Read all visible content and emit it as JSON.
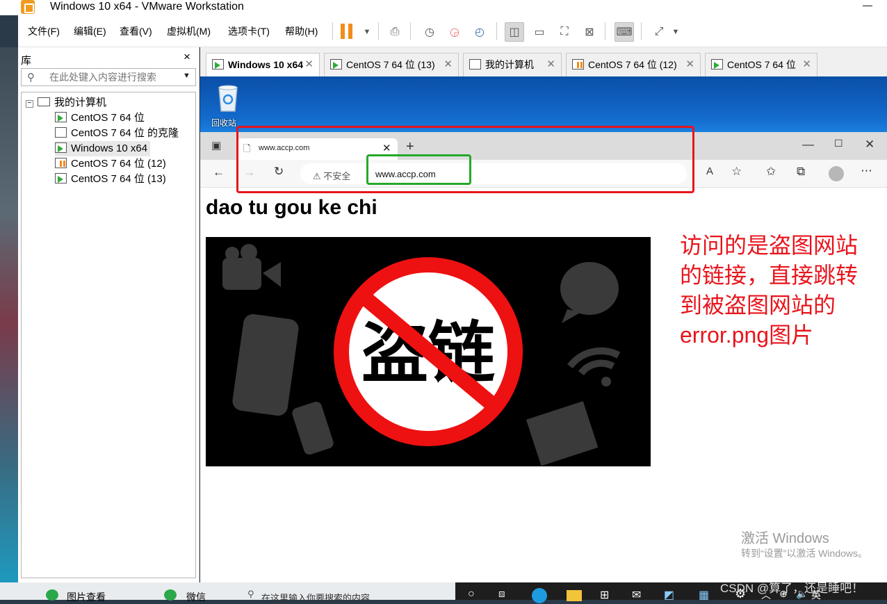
{
  "window": {
    "title": "Windows 10 x64 - VMware Workstation",
    "minimize_glyph": "—"
  },
  "menu": [
    "文件(F)",
    "编辑(E)",
    "查看(V)",
    "虚拟机(M)",
    "选项卡(T)",
    "帮助(H)"
  ],
  "toolbar_icons": [
    "pause-icon",
    "dropdown-icon",
    "send-keys-icon",
    "snapshot-icon",
    "revert-snapshot-icon",
    "snapshot-manager-icon",
    "library-view-icon",
    "console-view-icon",
    "fullscreen-icon",
    "unity-icon",
    "terminal-icon",
    "stretch-icon"
  ],
  "library": {
    "title": "库",
    "close": "×",
    "search_placeholder": "在此处键入内容进行搜索",
    "root": "我的计算机",
    "items": [
      {
        "label": "CentOS 7 64 位",
        "state": "run"
      },
      {
        "label": "CentOS 7 64 位 的克隆",
        "state": "off"
      },
      {
        "label": "Windows 10 x64",
        "state": "run",
        "selected": true
      },
      {
        "label": "CentOS 7 64 位 (12)",
        "state": "pause"
      },
      {
        "label": "CentOS 7 64 位 (13)",
        "state": "run"
      }
    ]
  },
  "tabs": [
    {
      "label": "Windows 10 x64",
      "active": true,
      "state": "run"
    },
    {
      "label": "CentOS 7 64 位 (13)",
      "state": "run"
    },
    {
      "label": "我的计算机",
      "state": "computer"
    },
    {
      "label": "CentOS 7 64 位 (12)",
      "state": "pause"
    },
    {
      "label": "CentOS 7 64 位",
      "state": "run"
    }
  ],
  "guest": {
    "recycle_bin": "回收站",
    "browser": {
      "tab_title": "www.accp.com",
      "not_secure": "不安全",
      "url": "www.accp.com"
    },
    "page_heading": "dao tu gou ke chi",
    "image_text": "盗链",
    "annotation": "访问的是盗图网站的链接，直接跳转到被盗图网站的error.png图片",
    "activate_title": "激活 Windows",
    "activate_sub": "转到“设置”以激活 Windows。"
  },
  "taskbar": {
    "host_items": [
      "图片查看",
      "微信"
    ],
    "search_placeholder": "在这里输入你要搜索的内容",
    "ime": "英",
    "watermark": "CSDN @算了，还是睡吧！"
  },
  "colors": {
    "annotation": "#e8141c",
    "highlight_red": "#e8141c",
    "highlight_green": "#25a82a",
    "play": "#2eab3a",
    "pause": "#f28c1c"
  }
}
